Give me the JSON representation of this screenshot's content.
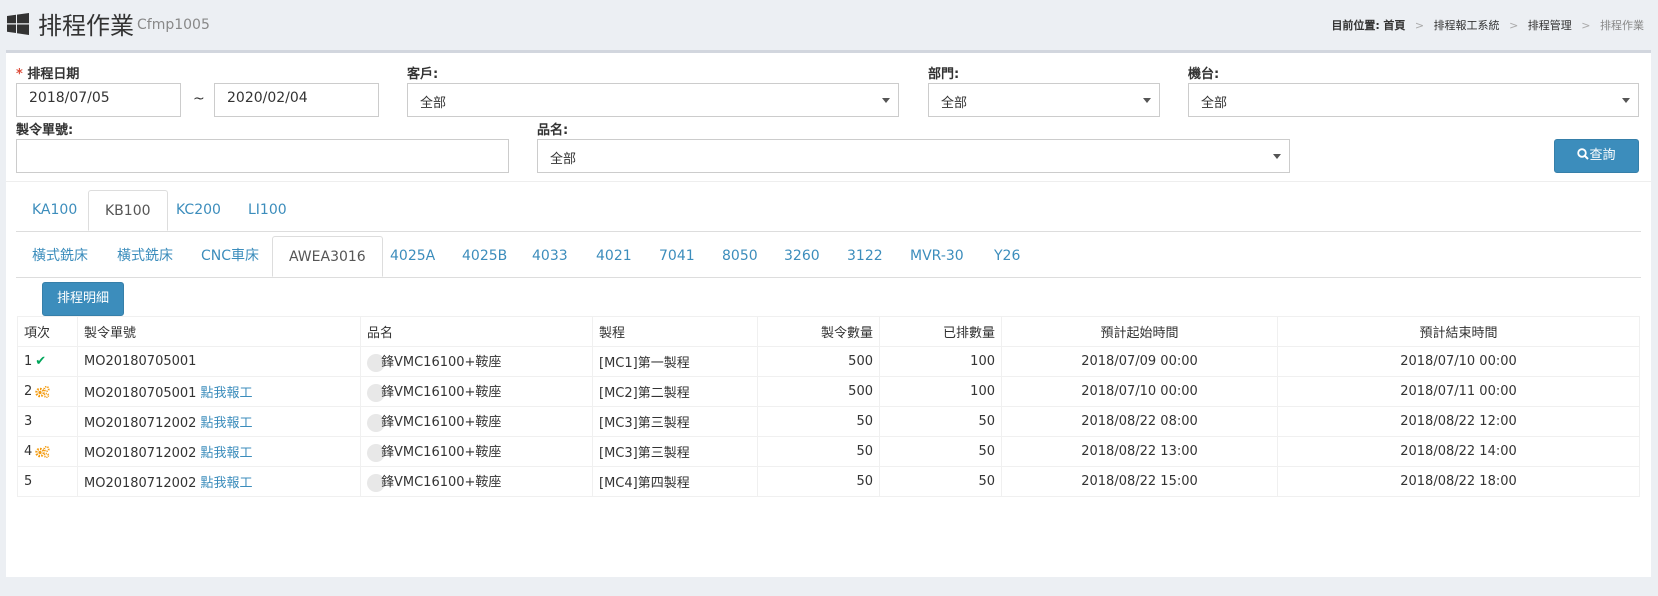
{
  "header": {
    "title": "排程作業",
    "subtitle": "Cfmp1005",
    "breadcrumb": {
      "label": "目前位置:",
      "items": [
        "首頁",
        "排程報工系統",
        "排程管理",
        "排程作業"
      ]
    }
  },
  "filters": {
    "date_label": "排程日期",
    "date_from": "2018/07/05",
    "date_sep": "~",
    "date_to": "2020/02/04",
    "customer_label": "客戶:",
    "customer_value": "全部",
    "dept_label": "部門:",
    "dept_value": "全部",
    "machine_label": "機台:",
    "machine_value": "全部",
    "order_label": "製令單號:",
    "order_value": "",
    "product_label": "品名:",
    "product_value": "全部",
    "query_button": "查詢"
  },
  "factory_tabs": [
    "KA100",
    "KB100",
    "KC200",
    "LI100"
  ],
  "factory_active": 1,
  "machine_tabs": [
    "橫式銑床",
    "橫式銑床",
    "CNC車床",
    "AWEA3016",
    "4025A",
    "4025B",
    "4033",
    "4021",
    "7041",
    "8050",
    "3260",
    "3122",
    "MVR-30",
    "Y26"
  ],
  "machine_active": 3,
  "detail_button": "排程明細",
  "table": {
    "headers": [
      "項次",
      "製令單號",
      "品名",
      "製程",
      "製令數量",
      "已排數量",
      "預計起始時間",
      "預計結束時間"
    ],
    "report_link": "點我報工",
    "rows": [
      {
        "no": "1",
        "status": "check",
        "order": "MO20180705001",
        "link": false,
        "product": "鋒VMC16100+鞍座",
        "process": "[MC1]第一製程",
        "qty": "500",
        "scheduled": "100",
        "start": "2018/07/09 00:00",
        "end": "2018/07/10 00:00"
      },
      {
        "no": "2",
        "status": "gear",
        "order": "MO20180705001",
        "link": true,
        "product": "鋒VMC16100+鞍座",
        "process": "[MC2]第二製程",
        "qty": "500",
        "scheduled": "100",
        "start": "2018/07/10 00:00",
        "end": "2018/07/11 00:00"
      },
      {
        "no": "3",
        "status": "",
        "order": "MO20180712002",
        "link": true,
        "product": "鋒VMC16100+鞍座",
        "process": "[MC3]第三製程",
        "qty": "50",
        "scheduled": "50",
        "start": "2018/08/22 08:00",
        "end": "2018/08/22 12:00"
      },
      {
        "no": "4",
        "status": "gear",
        "order": "MO20180712002",
        "link": true,
        "product": "鋒VMC16100+鞍座",
        "process": "[MC3]第三製程",
        "qty": "50",
        "scheduled": "50",
        "start": "2018/08/22 13:00",
        "end": "2018/08/22 14:00"
      },
      {
        "no": "5",
        "status": "",
        "order": "MO20180712002",
        "link": true,
        "product": "鋒VMC16100+鞍座",
        "process": "[MC4]第四製程",
        "qty": "50",
        "scheduled": "50",
        "start": "2018/08/22 15:00",
        "end": "2018/08/22 18:00"
      }
    ]
  },
  "colors": {
    "primary": "#3c8dbc",
    "required": "#dd4b39",
    "check": "#00a65a",
    "gear": "#f39c12"
  }
}
